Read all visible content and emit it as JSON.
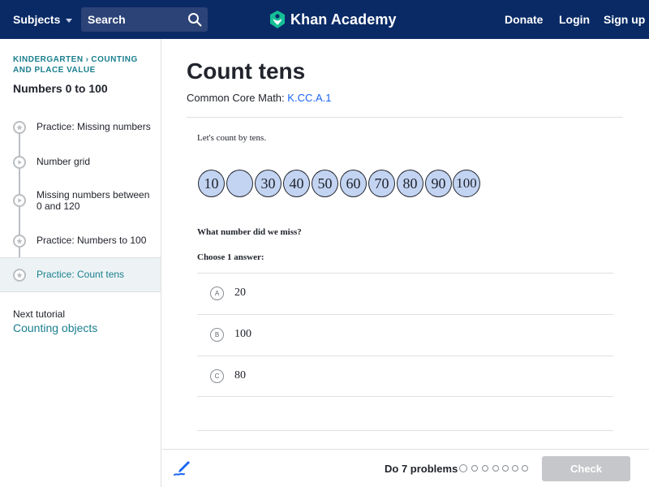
{
  "nav": {
    "subjects_label": "Subjects",
    "search_placeholder": "Search",
    "logo_text": "Khan Academy",
    "donate_label": "Donate",
    "login_label": "Login",
    "signup_label": "Sign up"
  },
  "sidebar": {
    "breadcrumb": [
      "Kindergarten",
      "Counting and place value"
    ],
    "unit_title": "Numbers 0 to 100",
    "items": [
      {
        "label": "Practice: Missing numbers",
        "icon": "star-icon",
        "active": false
      },
      {
        "label": "Number grid",
        "icon": "play-icon",
        "active": false
      },
      {
        "label": "Missing numbers between 0 and 120",
        "icon": "play-icon",
        "active": false
      },
      {
        "label": "Practice: Numbers to 100",
        "icon": "star-icon",
        "active": false
      },
      {
        "label": "Practice: Count tens",
        "icon": "star-icon",
        "active": true
      }
    ],
    "next_label": "Next tutorial",
    "next_link": "Counting objects"
  },
  "main": {
    "title": "Count tens",
    "standard_prefix": "Common Core Math:",
    "standard_code": "K.CC.A.1",
    "prompt": "Let's count by tens.",
    "sequence": [
      "10",
      "",
      "30",
      "40",
      "50",
      "60",
      "70",
      "80",
      "90",
      "100"
    ],
    "question": "What number did we miss?",
    "choose_label": "Choose 1 answer:",
    "choices": [
      {
        "letter": "A",
        "text": "20"
      },
      {
        "letter": "B",
        "text": "100"
      },
      {
        "letter": "C",
        "text": "80"
      }
    ]
  },
  "footer": {
    "progress_label": "Do 7 problems",
    "problem_count": 7,
    "check_label": "Check"
  },
  "colors": {
    "nav_bg": "#0a2a66",
    "accent_teal": "#1a7f8e",
    "link_blue": "#1865f2",
    "circle_fill": "#c3d4f2",
    "check_disabled": "#c5c7ca"
  }
}
